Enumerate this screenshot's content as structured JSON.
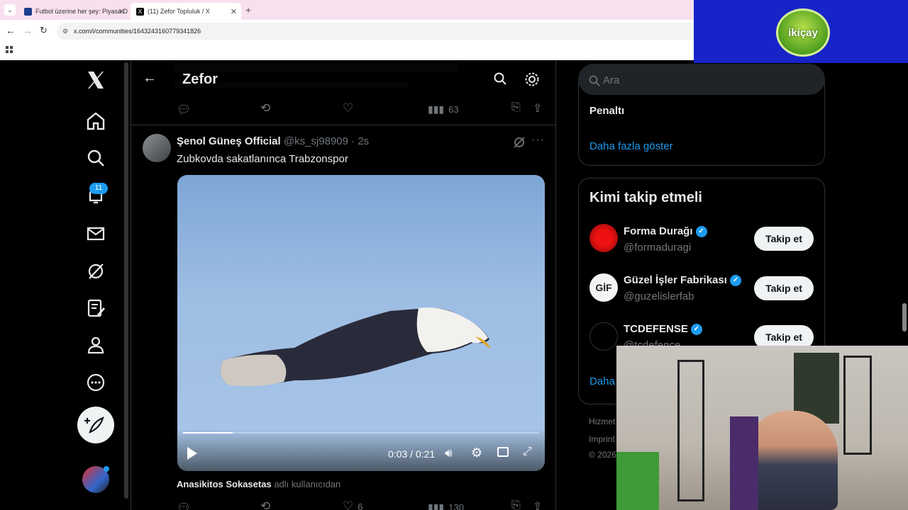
{
  "browser": {
    "tabs": [
      {
        "label": "Futbol üzerine her şey: Piyasa D",
        "active": false
      },
      {
        "label": "(11) Zefor Topluluk / X",
        "active": true
      }
    ],
    "url": "x.com/i/communities/1643243160779341826"
  },
  "overlay_logo": {
    "text": "ikiçay"
  },
  "nav": {
    "items": [
      "x-logo",
      "home",
      "explore",
      "notifications",
      "messages",
      "grok",
      "communities",
      "profile",
      "more"
    ],
    "notification_count": "11"
  },
  "header": {
    "title": "Zefor"
  },
  "prev_post": {
    "views": "63"
  },
  "post": {
    "author_name": "Şenol Güneş Official",
    "handle": "@ks_sj98909",
    "time": "· 2s",
    "text": "Zubkovda sakatlanınca Trabzonspor",
    "video_time": "0:03 / 0:21",
    "video_progress": 0.14
  },
  "next_post": {
    "author_name": "Anasikitos Sokasetas",
    "suffix": "adlı kullanıcıdan",
    "likes": "6",
    "views": "130"
  },
  "sidebar": {
    "search_placeholder": "Ara",
    "trend_text": "Penaltı",
    "show_more": "Daha fazla göster",
    "who_to_follow_title": "Kimi takip etmeli",
    "suggestions": [
      {
        "name": "Forma Durağı",
        "handle": "@formaduragi",
        "button": "Takip et",
        "color": "#c8102e"
      },
      {
        "name": "Güzel İşler Fabrikası",
        "handle": "@guzelislerfab",
        "button": "Takip et",
        "color": "#f4f4f4"
      },
      {
        "name": "TCDEFENSE",
        "handle": "@tcdefence",
        "button": "Takip et",
        "color": "#000000"
      }
    ],
    "show_more_short": "Daha",
    "footer": [
      "Hizmet",
      "Imprint",
      "© 2026"
    ]
  },
  "colors": {
    "accent": "#1d9bf0",
    "background": "#000000",
    "text": "#e7e9ea",
    "muted": "#71767b"
  }
}
